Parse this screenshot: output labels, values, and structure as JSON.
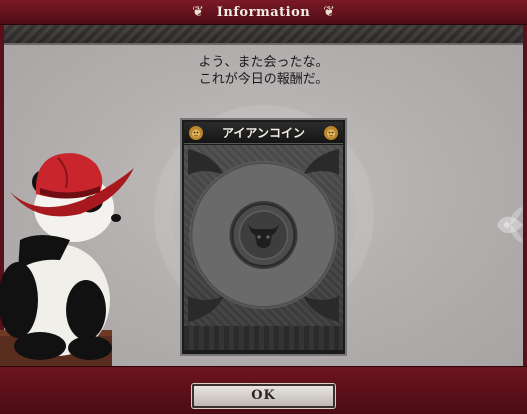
{
  "header": {
    "title": "Information"
  },
  "message": {
    "line1": "よう、また会ったな。",
    "line2": "これが今日の報酬だ。"
  },
  "card": {
    "title": "アイアンコイン"
  },
  "buttons": {
    "ok_label": "OK"
  },
  "colors": {
    "frame": "#5a0f1a",
    "panel": "#b8b4b4",
    "card_bg": "#1b1b1b",
    "hat_red": "#c8262c"
  },
  "icons": {
    "header_ornament": "scroll-ornament-icon",
    "card_corner": "lion-head-icon",
    "coin_emblem": "bull-head-icon",
    "character": "panda-with-red-cowboy-hat"
  }
}
